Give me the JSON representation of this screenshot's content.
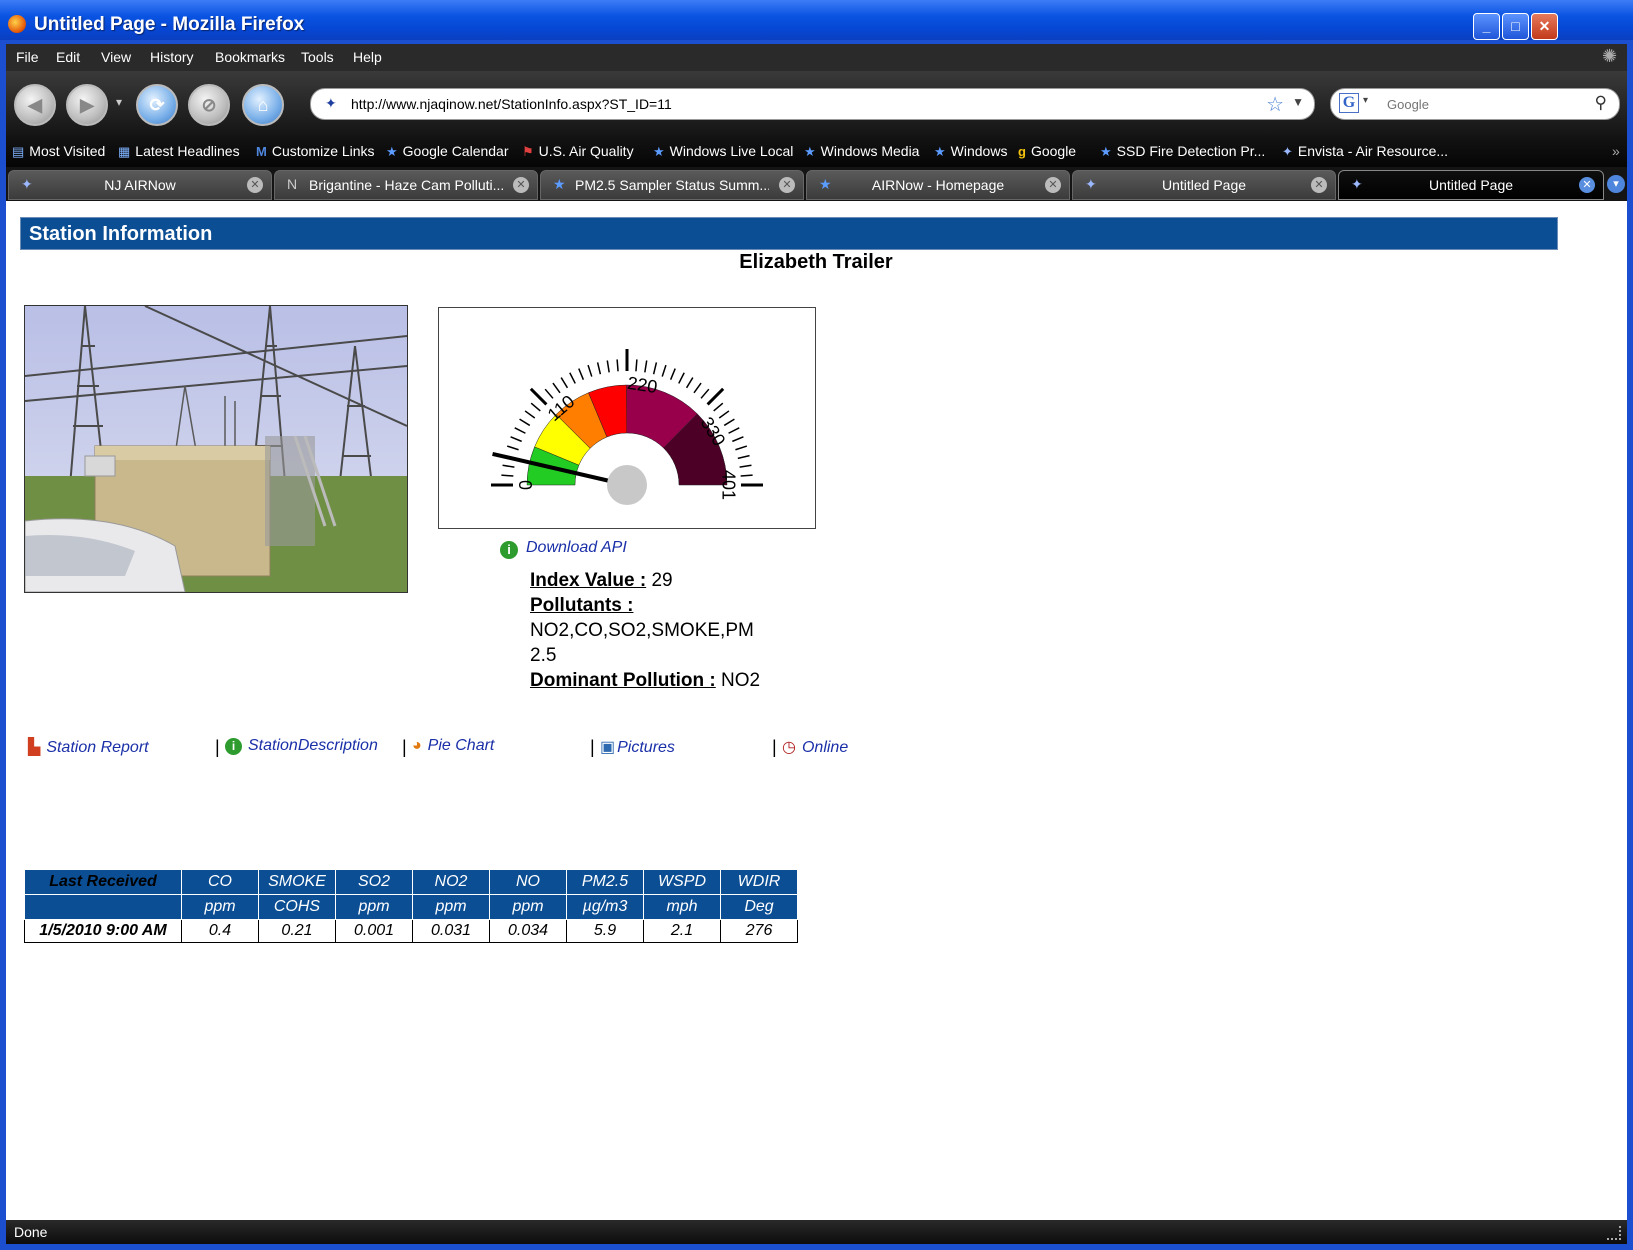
{
  "window": {
    "title": "Untitled Page - Mozilla Firefox",
    "buttons": {
      "minimize": "_",
      "maximize": "□",
      "close": "✕"
    }
  },
  "menu": [
    "File",
    "Edit",
    "View",
    "History",
    "Bookmarks",
    "Tools",
    "Help"
  ],
  "nav": {
    "url": "http://www.njaqinow.net/StationInfo.aspx?ST_ID=11",
    "search_placeholder": "Google"
  },
  "bookmarks": [
    {
      "label": "Most Visited",
      "icon": "folder-icon"
    },
    {
      "label": "Latest Headlines",
      "icon": "rss-icon"
    },
    {
      "label": "Customize Links",
      "icon": "m-icon"
    },
    {
      "label": "Google Calendar",
      "icon": "star-icon"
    },
    {
      "label": "U.S. Air Quality",
      "icon": "flag-icon"
    },
    {
      "label": "Windows Live Local",
      "icon": "star-icon"
    },
    {
      "label": "Windows Media",
      "icon": "star-icon"
    },
    {
      "label": "Windows",
      "icon": "star-icon"
    },
    {
      "label": "Google",
      "icon": "google-icon"
    },
    {
      "label": "SSD Fire Detection Pr...",
      "icon": "star-icon"
    },
    {
      "label": "Envista - Air Resource...",
      "icon": "site-icon"
    }
  ],
  "tabs": [
    {
      "label": "NJ AIRNow",
      "active": false
    },
    {
      "label": "Brigantine - Haze Cam Polluti...",
      "active": false
    },
    {
      "label": "PM2.5 Sampler Status Summ...",
      "active": false
    },
    {
      "label": "AIRNow - Homepage",
      "active": false
    },
    {
      "label": "Untitled Page",
      "active": false
    },
    {
      "label": "Untitled Page",
      "active": true
    }
  ],
  "page": {
    "header": "Station Information",
    "station_name": "Elizabeth Trailer",
    "gauge": {
      "value": 29,
      "min": 0,
      "max": 401,
      "major_labels": [
        "0",
        "110",
        "220",
        "330",
        "401"
      ],
      "bands": [
        {
          "from": 0,
          "to": 50,
          "color": "#22cc22"
        },
        {
          "from": 50,
          "to": 100,
          "color": "#ffff00"
        },
        {
          "from": 100,
          "to": 150,
          "color": "#ff7e00"
        },
        {
          "from": 150,
          "to": 200,
          "color": "#ff0000"
        },
        {
          "from": 200,
          "to": 300,
          "color": "#99004c"
        },
        {
          "from": 300,
          "to": 401,
          "color": "#4c0026"
        }
      ]
    },
    "download_api": "Download API",
    "index_label": "Index Value :",
    "index_value": "29",
    "pollutants_label": "Pollutants :",
    "pollutants_value": "NO2,CO,SO2,SMOKE,PM2.5",
    "dominant_label": "Dominant Pollution :",
    "dominant_value": "NO2",
    "links": [
      {
        "label": "Station Report",
        "icon": "bar-chart-icon"
      },
      {
        "label": "StationDescription",
        "icon": "info-icon"
      },
      {
        "label": "Pie Chart",
        "icon": "pie-chart-icon"
      },
      {
        "label": "Pictures",
        "icon": "picture-icon"
      },
      {
        "label": "Online",
        "icon": "clock-icon"
      }
    ],
    "separator": "|",
    "table": {
      "headers": [
        "Last Received",
        "CO",
        "SMOKE",
        "SO2",
        "NO2",
        "NO",
        "PM2.5",
        "WSPD",
        "WDIR"
      ],
      "units": [
        "",
        "ppm",
        "COHS",
        "ppm",
        "ppm",
        "ppm",
        "µg/m3",
        "mph",
        "Deg"
      ],
      "rows": [
        [
          "1/5/2010 9:00 AM",
          "0.4",
          "0.21",
          "0.001",
          "0.031",
          "0.034",
          "5.9",
          "2.1",
          "276"
        ]
      ]
    }
  },
  "status": "Done"
}
